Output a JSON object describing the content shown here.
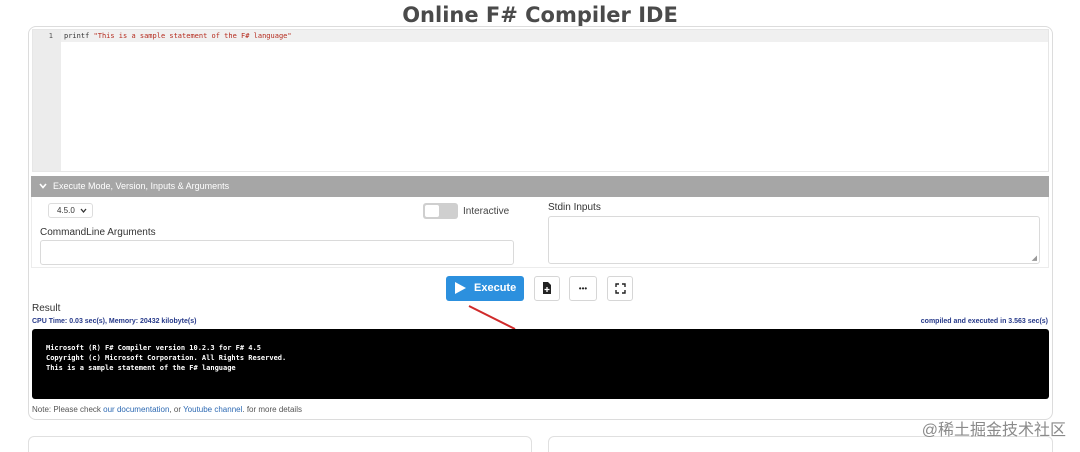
{
  "page": {
    "title": "Online F# Compiler IDE"
  },
  "editor": {
    "line_number": "1",
    "code_keyword": "printf ",
    "code_string": "\"This is a sample statement of the F# language\""
  },
  "options": {
    "header_label": "Execute Mode, Version, Inputs & Arguments",
    "version_selected": "4.5.0",
    "interactive_label": "Interactive",
    "interactive_on": false,
    "cmdline_label": "CommandLine Arguments",
    "cmdline_value": "",
    "stdin_label": "Stdin Inputs",
    "stdin_value": ""
  },
  "toolbar": {
    "execute_label": "Execute",
    "more_glyph": "•••"
  },
  "result": {
    "label": "Result",
    "cpu_memory": "CPU Time: 0.03 sec(s), Memory: 20432 kilobyte(s)",
    "compiled_time": "compiled and executed in 3.563 sec(s)",
    "output_lines": [
      "Microsoft (R) F# Compiler version 10.2.3 for F# 4.5",
      "Copyright (c) Microsoft Corporation. All Rights Reserved.",
      "This is a sample statement of the F# language"
    ]
  },
  "note": {
    "prefix": "Note: Please check ",
    "doc_link": "our documentation",
    "middle": ", or ",
    "youtube_link": "Youtube channel",
    "suffix": ". for more details"
  },
  "watermark": "@稀土掘金技术社区",
  "colors": {
    "accent": "#2c90de",
    "info_text": "#273a8a",
    "code_string": "#b52a1d",
    "annotation_arrow": "#d02a2a"
  },
  "icons": {
    "accordion": "chevron-down-icon",
    "execute": "play-icon",
    "new_file": "file-plus-icon",
    "more": "more-dots-icon",
    "fullscreen": "fullscreen-icon"
  }
}
